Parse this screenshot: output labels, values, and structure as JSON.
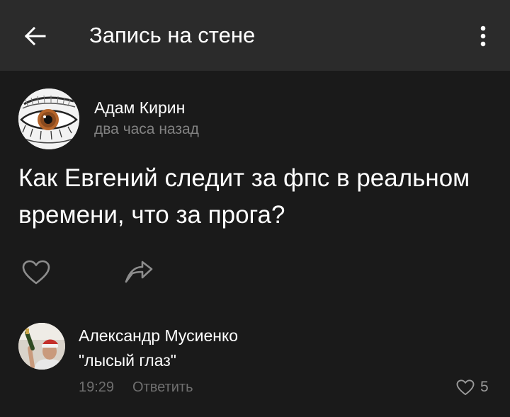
{
  "header": {
    "title": "Запись на стене",
    "back_icon": "arrow-left-icon",
    "menu_icon": "more-vertical-icon"
  },
  "post": {
    "author": "Адам Кирин",
    "time": "два часа назад",
    "text": "Как Евгений следит за фпс в реальном времени, что за прога?",
    "avatar": "eye-avatar",
    "actions": {
      "like_icon": "heart-outline-icon",
      "share_icon": "share-arrow-icon"
    }
  },
  "comment": {
    "author": "Александр Мусиенко",
    "text": "\"лысый глаз\"",
    "time": "19:29",
    "reply_label": "Ответить",
    "likes": "5",
    "like_icon": "heart-outline-icon"
  },
  "colors": {
    "background": "#1a1a1a",
    "topbar": "#2b2b2b",
    "secondary_text": "#828282",
    "tertiary_text": "#6f6f6f"
  }
}
